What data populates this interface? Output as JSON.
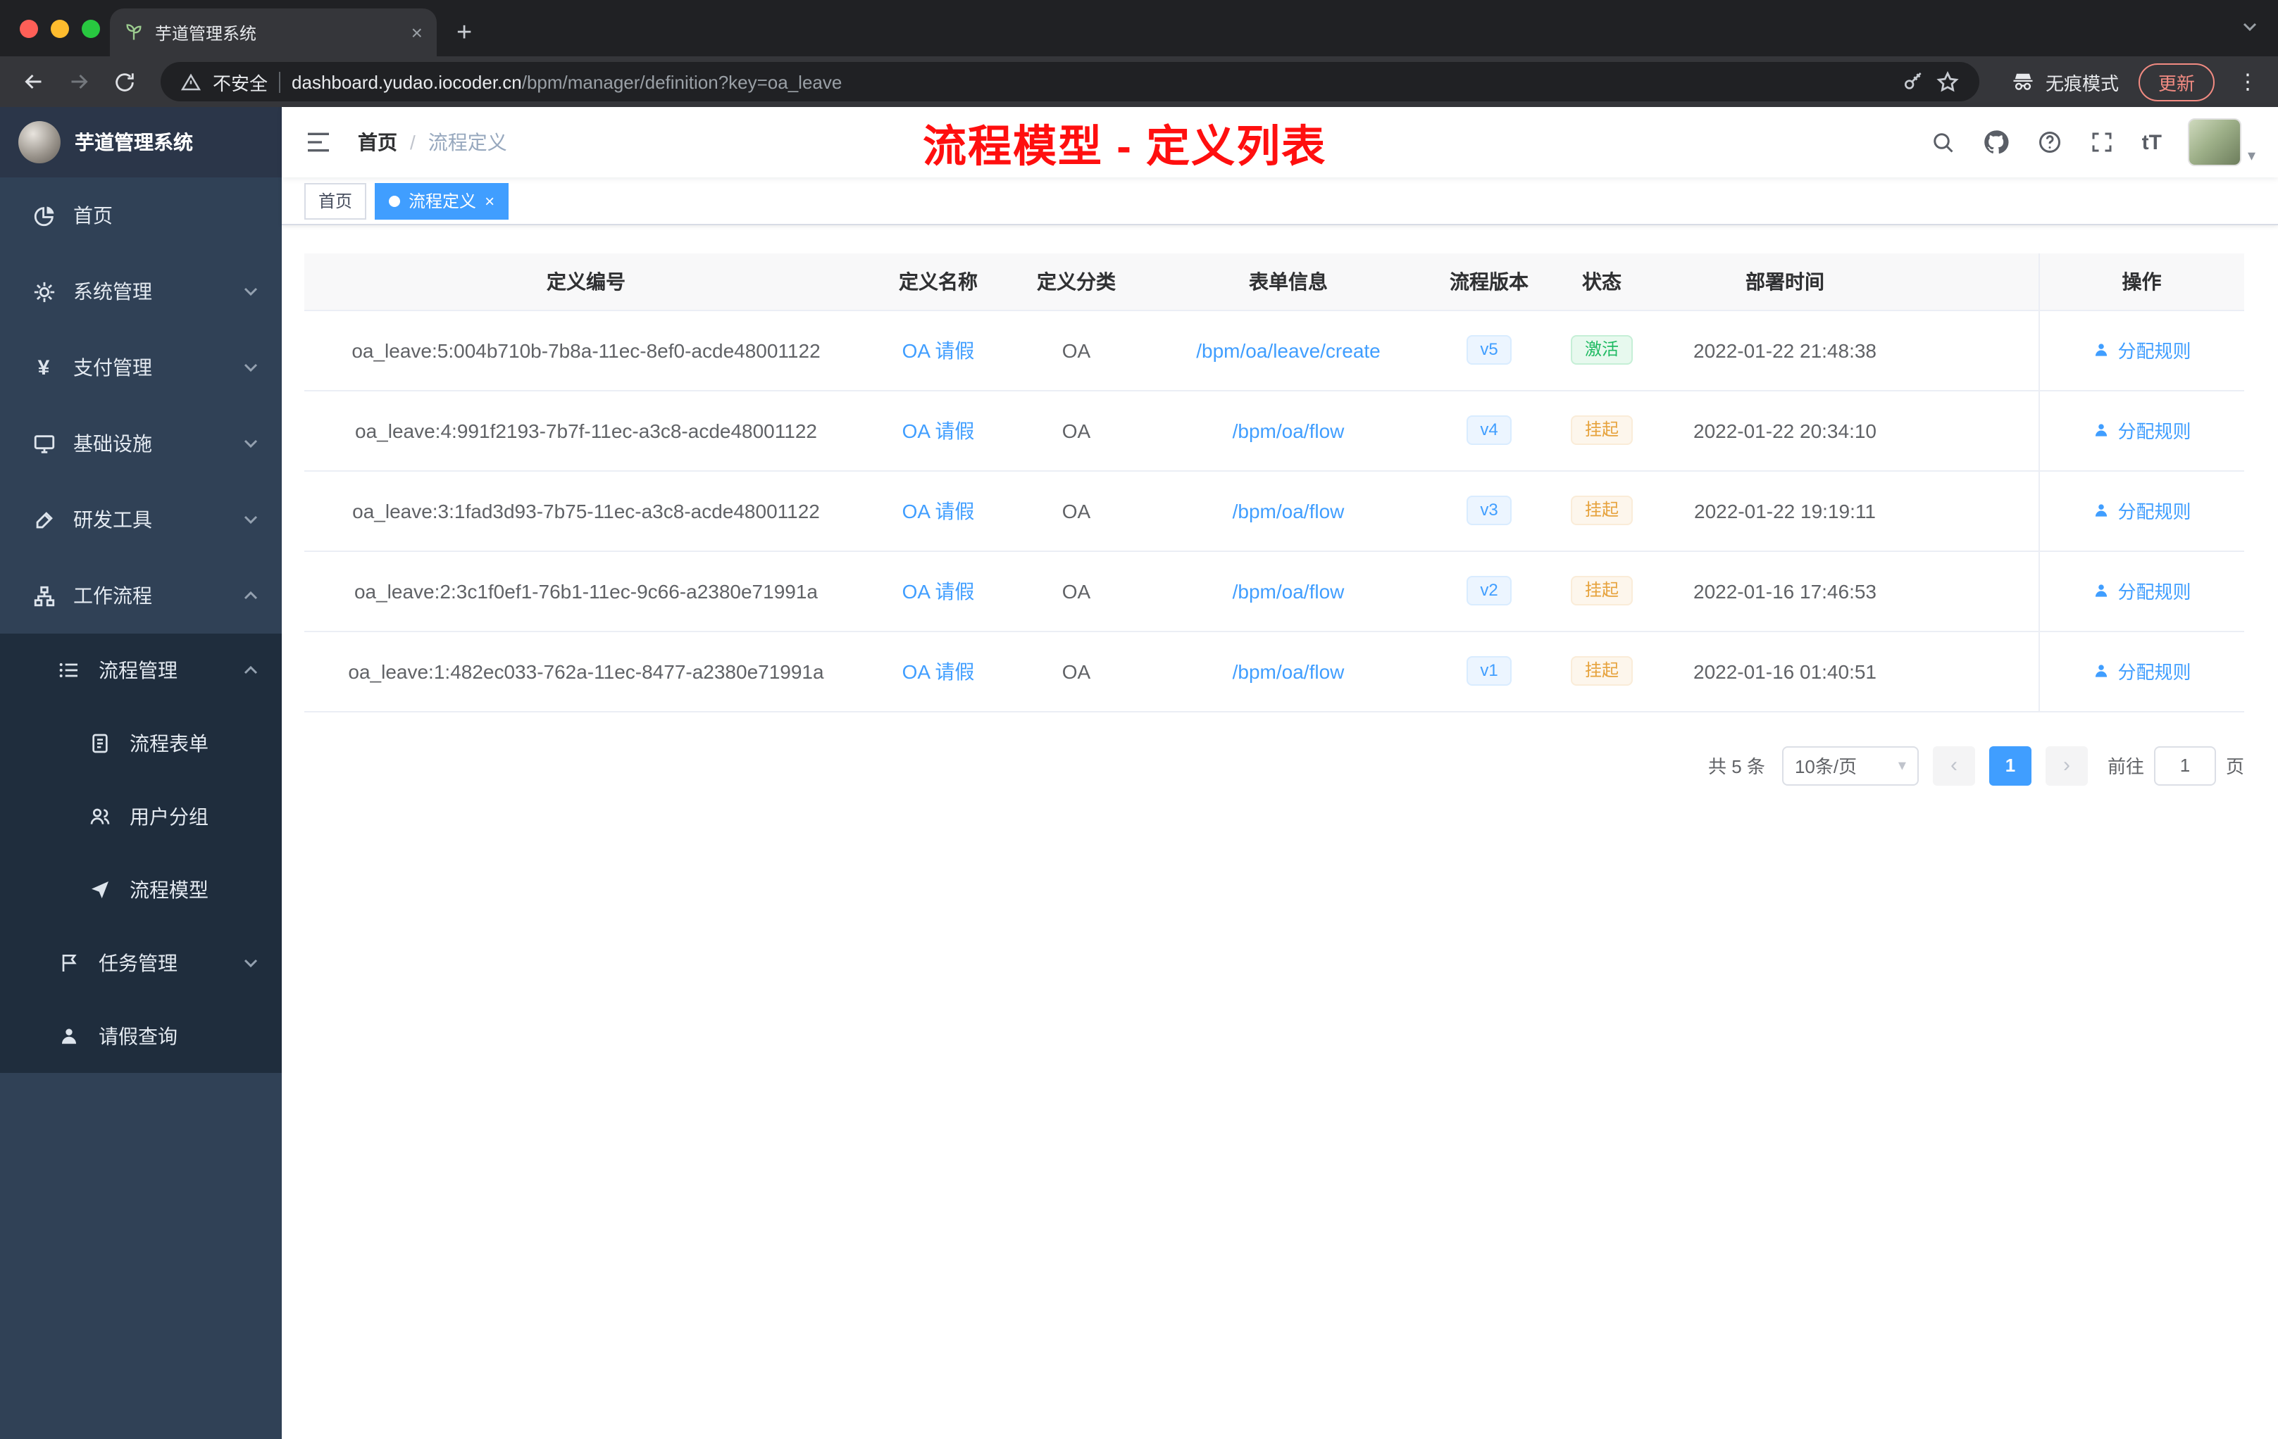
{
  "browser": {
    "tab_title": "芋道管理系统",
    "not_secure": "不安全",
    "url_host": "dashboard.yudao.iocoder.cn",
    "url_path": "/bpm/manager/definition?key=oa_leave",
    "incognito": "无痕模式",
    "update": "更新"
  },
  "icons": {
    "close": "×",
    "plus": "+",
    "kebab": "⋮",
    "caret": "▾",
    "chevron_left": "‹",
    "chevron_right": "›"
  },
  "sidebar": {
    "title": "芋道管理系统",
    "menu": [
      {
        "label": "首页"
      },
      {
        "label": "系统管理"
      },
      {
        "label": "支付管理"
      },
      {
        "label": "基础设施"
      },
      {
        "label": "研发工具"
      },
      {
        "label": "工作流程"
      }
    ],
    "submenu": [
      {
        "label": "流程管理"
      },
      {
        "label": "流程表单"
      },
      {
        "label": "用户分组"
      },
      {
        "label": "流程模型"
      },
      {
        "label": "任务管理"
      },
      {
        "label": "请假查询"
      }
    ]
  },
  "navbar": {
    "breadcrumb_home": "首页",
    "breadcrumb_sep": "/",
    "breadcrumb_current": "流程定义",
    "annotation": "流程模型 - 定义列表",
    "font_icon": "tT"
  },
  "tags": {
    "home": "首页",
    "current": "流程定义"
  },
  "table": {
    "columns": [
      "定义编号",
      "定义名称",
      "定义分类",
      "表单信息",
      "流程版本",
      "状态",
      "部署时间",
      "操作"
    ],
    "rows": [
      {
        "id": "oa_leave:5:004b710b-7b8a-11ec-8ef0-acde48001122",
        "name": "OA 请假",
        "category": "OA",
        "form": "/bpm/oa/leave/create",
        "version": "v5",
        "status": "激活",
        "deployed": "2022-01-22 21:48:38",
        "action": "分配规则"
      },
      {
        "id": "oa_leave:4:991f2193-7b7f-11ec-a3c8-acde48001122",
        "name": "OA 请假",
        "category": "OA",
        "form": "/bpm/oa/flow",
        "version": "v4",
        "status": "挂起",
        "deployed": "2022-01-22 20:34:10",
        "action": "分配规则"
      },
      {
        "id": "oa_leave:3:1fad3d93-7b75-11ec-a3c8-acde48001122",
        "name": "OA 请假",
        "category": "OA",
        "form": "/bpm/oa/flow",
        "version": "v3",
        "status": "挂起",
        "deployed": "2022-01-22 19:19:11",
        "action": "分配规则"
      },
      {
        "id": "oa_leave:2:3c1f0ef1-76b1-11ec-9c66-a2380e71991a",
        "name": "OA 请假",
        "category": "OA",
        "form": "/bpm/oa/flow",
        "version": "v2",
        "status": "挂起",
        "deployed": "2022-01-16 17:46:53",
        "action": "分配规则"
      },
      {
        "id": "oa_leave:1:482ec033-762a-11ec-8477-a2380e71991a",
        "name": "OA 请假",
        "category": "OA",
        "form": "/bpm/oa/flow",
        "version": "v1",
        "status": "挂起",
        "deployed": "2022-01-16 01:40:51",
        "action": "分配规则"
      }
    ]
  },
  "pagination": {
    "total": "共 5 条",
    "size": "10条/页",
    "page": "1",
    "goto": "前往",
    "unit": "页",
    "goto_value": "1"
  },
  "colors": {
    "accent": "#409eff",
    "success": "#1fba62",
    "warning": "#e6a23c",
    "annotation": "#ff0f0f",
    "sidebar_bg": "#304156",
    "submenu_bg": "#1f2d3d"
  }
}
